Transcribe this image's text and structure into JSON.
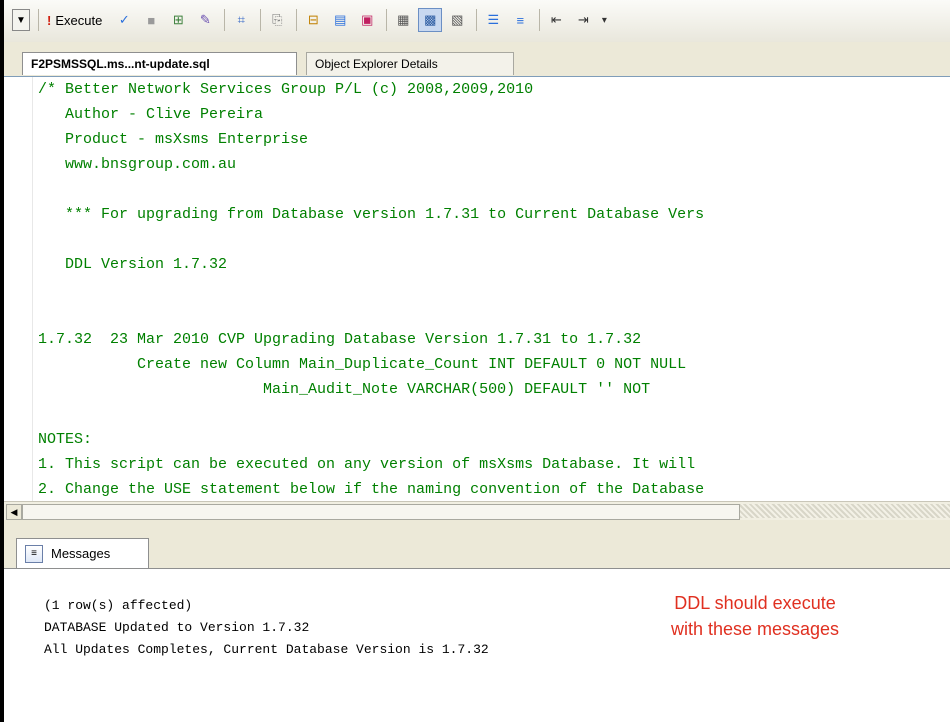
{
  "toolbar": {
    "execute_label": "Execute",
    "buttons": [
      "dropdown",
      "execute",
      "parse",
      "cancel",
      "display-plan",
      "query-options",
      "intellisense",
      "results-text",
      "results-grid",
      "results-file",
      "comment",
      "uncomment",
      "decrease-indent",
      "increase-indent"
    ]
  },
  "editor": {
    "tabs": [
      {
        "label": "F2PSMSSQL.ms...nt-update.sql",
        "active": true
      },
      {
        "label": "Object Explorer Details",
        "active": false
      }
    ],
    "code_lines": [
      "/* Better Network Services Group P/L (c) 2008,2009,2010",
      "   Author - Clive Pereira",
      "   Product - msXsms Enterprise",
      "   www.bnsgroup.com.au",
      "",
      "   *** For upgrading from Database version 1.7.31 to Current Database Vers",
      "",
      "   DDL Version 1.7.32",
      "",
      "",
      "1.7.32  23 Mar 2010 CVP Upgrading Database Version 1.7.31 to 1.7.32",
      "           Create new Column Main_Duplicate_Count INT DEFAULT 0 NOT NULL",
      "                         Main_Audit_Note VARCHAR(500) DEFAULT '' NOT",
      "",
      "NOTES:",
      "1. This script can be executed on any version of msXsms Database. It will",
      "2. Change the USE statement below if the naming convention of the Database"
    ]
  },
  "messages_panel": {
    "tab_label": "Messages",
    "lines": [
      "(1 row(s) affected)",
      "DATABASE Updated to Version 1.7.32",
      "All Updates Completes, Current Database Version is 1.7.32"
    ],
    "annotation_line1": "DDL should execute",
    "annotation_line2": "with these messages"
  },
  "colors": {
    "code_comment": "#008000",
    "annotation": "#e03020"
  }
}
